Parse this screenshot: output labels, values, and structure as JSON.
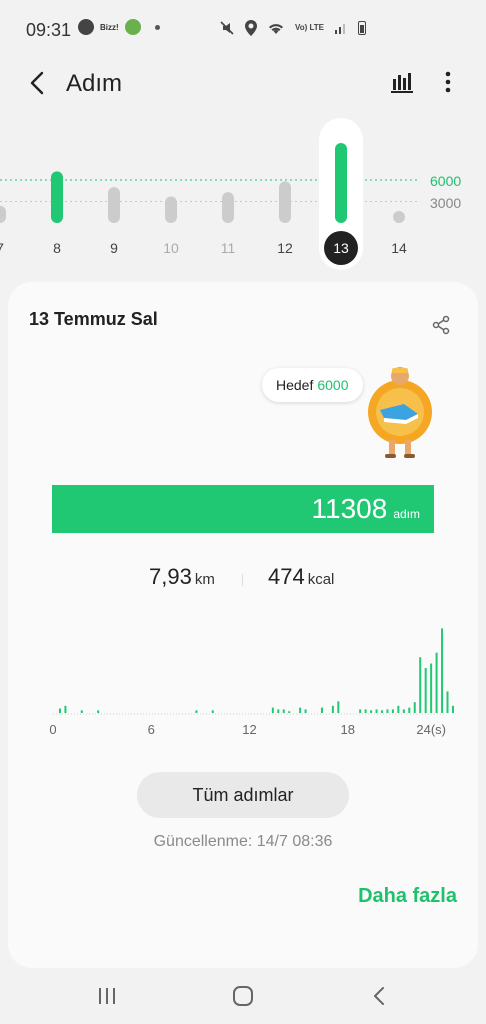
{
  "status_bar": {
    "time": "09:31",
    "left_icons": [
      "app-icon",
      "bizz-icon",
      "home-app-icon",
      "notification-dot"
    ],
    "bizz_label": "Bizz!",
    "lte_label": "Vo) LTE",
    "right_icons": [
      "mute-icon",
      "location-icon",
      "wifi-icon",
      "lte-icon",
      "signal-icon",
      "battery-icon"
    ]
  },
  "app_bar": {
    "title": "Adım"
  },
  "week": {
    "goal_value": 6000,
    "goal_label": "6000",
    "mid_label": "3000",
    "days": [
      {
        "label": "7",
        "steps": 2400
      },
      {
        "label": "8",
        "steps": 7200
      },
      {
        "label": "9",
        "steps": 5000
      },
      {
        "label": "10",
        "steps": 3700
      },
      {
        "label": "11",
        "steps": 4300
      },
      {
        "label": "12",
        "steps": 5800
      },
      {
        "label": "13",
        "steps": 11308,
        "selected": true
      },
      {
        "label": "14",
        "steps": 0
      }
    ]
  },
  "day_card": {
    "date": "13 Temmuz Sal",
    "target_label": "Hedef",
    "target_value": "6000",
    "steps": "11308",
    "steps_unit": "adım",
    "progress_fraction": 1.0,
    "distance_value": "7,93",
    "distance_unit": "km",
    "calories_value": "474",
    "calories_unit": "kcal",
    "all_steps_button": "Tüm adımlar",
    "updated": "Güncellenme: 14/7 08:36",
    "more_link": "Daha fazla"
  },
  "chart_data": {
    "type": "bar",
    "x_ticks": [
      "0",
      "6",
      "12",
      "18",
      "24(s)"
    ],
    "bars_per_hour": 3,
    "values": [
      0,
      0.5,
      0.8,
      0,
      0,
      0.3,
      0,
      0,
      0.3,
      0,
      0,
      0,
      0,
      0,
      0,
      0,
      0,
      0,
      0,
      0,
      0,
      0,
      0,
      0,
      0,
      0,
      0.3,
      0,
      0,
      0.3,
      0,
      0,
      0,
      0,
      0,
      0,
      0,
      0,
      0,
      0,
      0.6,
      0.4,
      0.4,
      0.2,
      0,
      0.6,
      0.4,
      0,
      0,
      0.6,
      0,
      0.8,
      1.3,
      0,
      0,
      0,
      0.4,
      0.4,
      0.3,
      0.4,
      0.3,
      0.4,
      0.4,
      0.8,
      0.4,
      0.6,
      1.2,
      6.2,
      5.0,
      5.5,
      6.7,
      9.4,
      2.4,
      0.8,
      0.4,
      0.8,
      0,
      0,
      0,
      0,
      0.4,
      0.8,
      0.4,
      0,
      0,
      0,
      2.5,
      7.9,
      6.6,
      0.8,
      0.4,
      0.8,
      0.4,
      0,
      0.4,
      0,
      0,
      0.4,
      0.8,
      0.8,
      1.6,
      3.6,
      2.4,
      1.2,
      0.4,
      0.8,
      0.4,
      0.4
    ],
    "ylim": [
      0,
      10
    ],
    "highlight_color": "#21c874",
    "baseline_color": "#d0d0d0"
  },
  "colors": {
    "accent": "#21c874",
    "inactive_bar": "#cccccc",
    "selected_day_bg": "#222222"
  },
  "nav_bar": {
    "items": [
      "recent-apps-icon",
      "home-icon",
      "back-icon"
    ]
  }
}
